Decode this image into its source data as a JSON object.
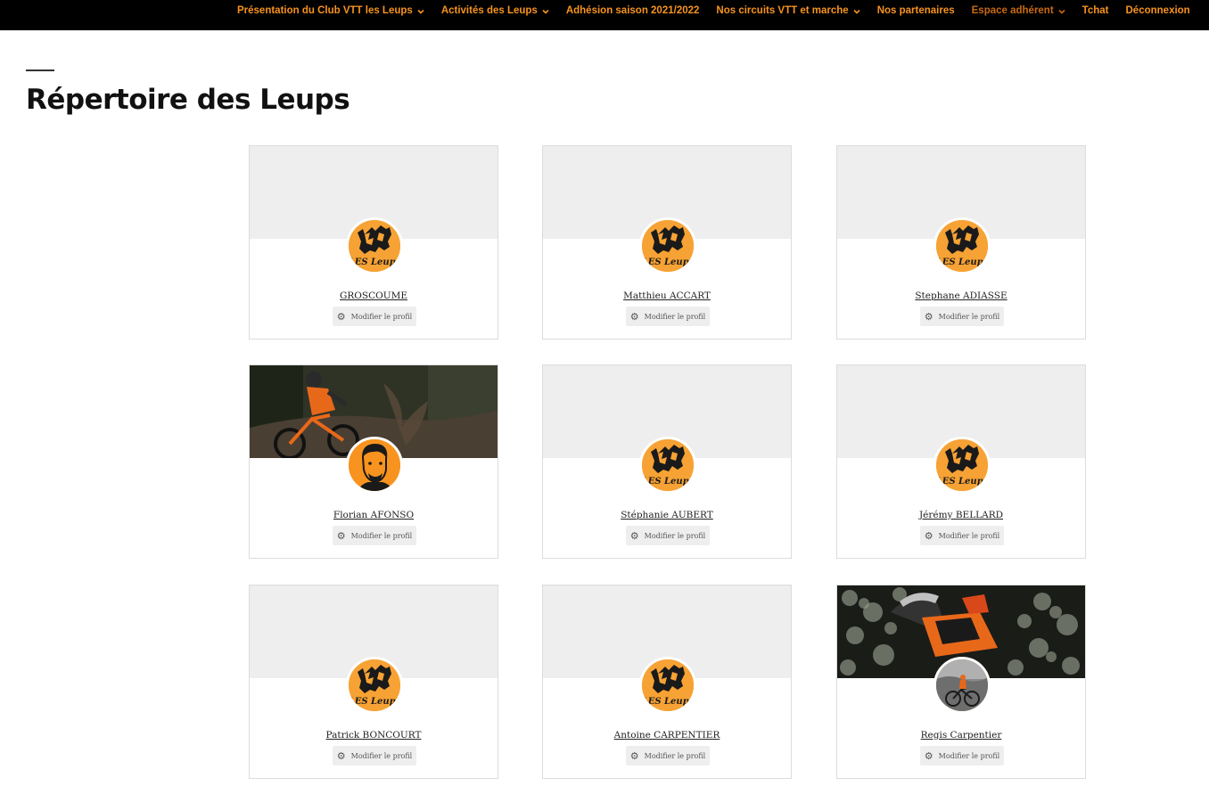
{
  "nav": {
    "items": [
      {
        "label": "Présentation du Club VTT les Leups",
        "dropdown": true,
        "active": false
      },
      {
        "label": "Activités des Leups",
        "dropdown": true,
        "active": false
      },
      {
        "label": "Adhésion saison 2021/2022",
        "dropdown": false,
        "active": false
      },
      {
        "label": "Nos circuits VTT et marche",
        "dropdown": true,
        "active": false
      },
      {
        "label": "Nos partenaires",
        "dropdown": false,
        "active": false
      },
      {
        "label": "Espace adhérent",
        "dropdown": true,
        "active": true
      },
      {
        "label": "Tchat",
        "dropdown": false,
        "active": false
      },
      {
        "label": "Déconnexion",
        "dropdown": false,
        "active": false
      }
    ],
    "chevron": "⌄"
  },
  "page": {
    "title": "Répertoire des Leups"
  },
  "members": [
    {
      "name": "GROSCOUME",
      "cover": "none",
      "avatar": "leups-logo-icon",
      "edit_label": "Modifier le profil"
    },
    {
      "name": "Matthieu ACCART",
      "cover": "none",
      "avatar": "leups-logo-icon",
      "edit_label": "Modifier le profil"
    },
    {
      "name": "Stephane ADIASSE",
      "cover": "none",
      "avatar": "leups-logo-icon",
      "edit_label": "Modifier le profil"
    },
    {
      "name": "Florian AFONSO",
      "cover": "mtb-photo",
      "avatar": "portrait-icon",
      "edit_label": "Modifier le profil"
    },
    {
      "name": "Stéphanie AUBERT",
      "cover": "none",
      "avatar": "leups-logo-icon",
      "edit_label": "Modifier le profil"
    },
    {
      "name": "Jérémy BELLARD",
      "cover": "none",
      "avatar": "leups-logo-icon",
      "edit_label": "Modifier le profil"
    },
    {
      "name": "Patrick BONCOURT",
      "cover": "none",
      "avatar": "leups-logo-icon",
      "edit_label": "Modifier le profil"
    },
    {
      "name": "Antoine CARPENTIER",
      "cover": "none",
      "avatar": "leups-logo-icon",
      "edit_label": "Modifier le profil"
    },
    {
      "name": "Regis Carpentier",
      "cover": "rider-photo",
      "avatar": "rider-avatar-icon",
      "edit_label": "Modifier le profil"
    }
  ],
  "colors": {
    "nav_bg": "#000000",
    "nav_link": "#f7931e",
    "nav_active": "#c96a12",
    "logo_orange": "#f7a234",
    "cover_grey": "#eeeeee"
  }
}
